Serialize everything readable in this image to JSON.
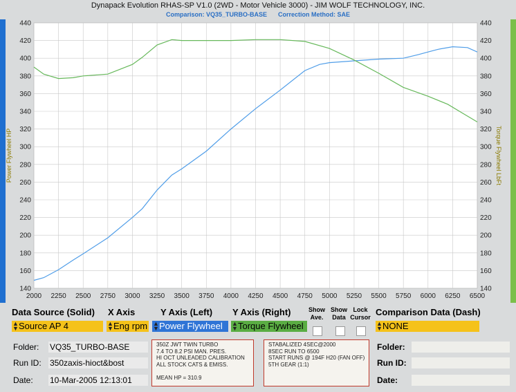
{
  "header": {
    "title": "Dynapack Evolution RHAS-SP V1.0   (2WD - Motor Vehicle 3000) - JIM WOLF TECHNOLOGY, INC.",
    "comparison": "Comparison: VQ35_TURBO-BASE",
    "correction": "Correction Method: SAE"
  },
  "chart_data": {
    "type": "line",
    "xlim": [
      2000,
      6500
    ],
    "x_ticks": [
      "2000",
      "2250",
      "2500",
      "2750",
      "3000",
      "3250",
      "3500",
      "3750",
      "4000",
      "4250",
      "4500",
      "4750",
      "5000",
      "5250",
      "5500",
      "5750",
      "6000",
      "6250",
      "6500"
    ],
    "ylim": [
      140,
      440
    ],
    "y_ticks": [
      "140",
      "160",
      "180",
      "200",
      "220",
      "240",
      "260",
      "280",
      "300",
      "320",
      "340",
      "360",
      "380",
      "400",
      "420",
      "440"
    ],
    "ylabel_left": "Power Flywheel HP",
    "ylabel_right": "Torque Flywheel LbFt",
    "grid": true,
    "series": [
      {
        "name": "Power Flywheel",
        "color": "#4f9de8",
        "x": [
          2000,
          2100,
          2250,
          2400,
          2500,
          2750,
          3000,
          3100,
          3250,
          3400,
          3500,
          3750,
          4000,
          4250,
          4500,
          4750,
          4900,
          5000,
          5250,
          5500,
          5750,
          5900,
          6000,
          6100,
          6250,
          6400,
          6500
        ],
        "y": [
          149,
          152,
          161,
          172,
          179,
          197,
          220,
          230,
          251,
          268,
          275,
          295,
          320,
          343,
          364,
          386,
          393,
          395,
          397,
          399,
          400,
          404,
          407,
          410,
          413,
          412,
          407
        ]
      },
      {
        "name": "Torque Flywheel",
        "color": "#66b85a",
        "x": [
          2000,
          2100,
          2250,
          2400,
          2500,
          2750,
          3000,
          3100,
          3250,
          3400,
          3500,
          3750,
          4000,
          4250,
          4500,
          4750,
          5000,
          5250,
          5500,
          5750,
          6000,
          6200,
          6350,
          6500
        ],
        "y": [
          390,
          382,
          377,
          378,
          380,
          382,
          393,
          401,
          415,
          421,
          420,
          420,
          420,
          421,
          421,
          419,
          411,
          398,
          383,
          367,
          357,
          348,
          338,
          328
        ]
      }
    ]
  },
  "controls": {
    "data_source_label": "Data Source (Solid)",
    "x_axis_label": "X Axis",
    "y_left_label": "Y Axis (Left)",
    "y_right_label": "Y Axis (Right)",
    "show_ave_label": "Show Ave.",
    "show_data_label": "Show Data",
    "lock_cursor_label": "Lock Cursor",
    "comparison_label": "Comparison Data (Dash)",
    "data_source_value": "Source AP 4",
    "x_axis_value": "Eng rpm",
    "y_left_value": "Power Flywheel",
    "y_right_value": "Torque Flywheel",
    "comparison_value": "NONE"
  },
  "info": {
    "folder_label": "Folder:",
    "folder_value": "VQ35_TURBO-BASE",
    "runid_label": "Run ID:",
    "runid_value": "350zaxis-hioct&bost",
    "date_label": "Date:",
    "date_value": "10-Mar-2005  12:13:01",
    "cmp_folder_label": "Folder:",
    "cmp_runid_label": "Run ID:",
    "cmp_date_label": "Date:"
  },
  "notes_left": [
    "350Z JWT TWIN TURBO",
    "7.4 TO 8.2 PSI MAN. PRES.",
    "HI OCT UNLEADED CALIBRATION",
    "ALL STOCK CATS & EMISS.",
    "",
    "MEAN HP = 310.9"
  ],
  "notes_right": [
    "STABALIZED 4SEC@2000",
    "8SEC RUN TO 6500",
    "START RUNS @ 194F H20 (FAN OFF)",
    "5TH GEAR (1:1)"
  ],
  "colors": {
    "blue_select": "#2f74d6",
    "yellow_select": "#f5c21a",
    "green_select": "#5aad43"
  }
}
